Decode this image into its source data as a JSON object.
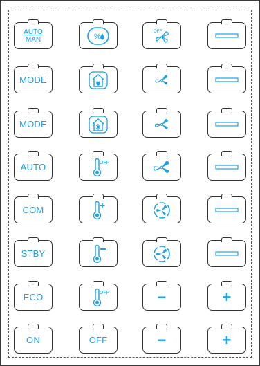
{
  "colors": {
    "accent": "#1da2e6",
    "border": "#333333",
    "bg": "#ffffff"
  },
  "rows": [
    {
      "col1": {
        "type": "stack",
        "top": "AUTO",
        "bottom": "MAN"
      },
      "col2": {
        "icon": "humidity-icon"
      },
      "col3": {
        "icon": "fan-off-icon",
        "label": "OFF"
      },
      "col4": {
        "icon": "blank-line-icon"
      }
    },
    {
      "col1": {
        "text": "MODE"
      },
      "col2": {
        "icon": "home-heat-icon"
      },
      "col3": {
        "icon": "fan-small-icon"
      },
      "col4": {
        "icon": "blank-line-icon"
      }
    },
    {
      "col1": {
        "text": "MODE"
      },
      "col2": {
        "icon": "home-cool-icon"
      },
      "col3": {
        "icon": "fan-medium-icon"
      },
      "col4": {
        "icon": "blank-line-icon"
      }
    },
    {
      "col1": {
        "text": "AUTO"
      },
      "col2": {
        "icon": "thermometer-off-icon",
        "label": "OFF"
      },
      "col3": {
        "icon": "fan-large-icon"
      },
      "col4": {
        "icon": "blank-line-icon"
      }
    },
    {
      "col1": {
        "text": "COM"
      },
      "col2": {
        "icon": "thermometer-plus-icon",
        "label": "+"
      },
      "col3": {
        "icon": "fan-cycle-icon"
      },
      "col4": {
        "icon": "blank-line-icon"
      }
    },
    {
      "col1": {
        "text": "STBY"
      },
      "col2": {
        "icon": "thermometer-minus-icon",
        "label": "−"
      },
      "col3": {
        "icon": "fan-cycle-icon"
      },
      "col4": {
        "icon": "blank-line-icon"
      }
    },
    {
      "col1": {
        "text": "ECO"
      },
      "col2": {
        "icon": "thermometer-off-icon",
        "label": "OFF"
      },
      "col3": {
        "text": "−"
      },
      "col4": {
        "text": "+"
      }
    },
    {
      "col1": {
        "text": "ON"
      },
      "col2": {
        "text": "OFF"
      },
      "col3": {
        "text": "−"
      },
      "col4": {
        "text": "+"
      }
    }
  ]
}
